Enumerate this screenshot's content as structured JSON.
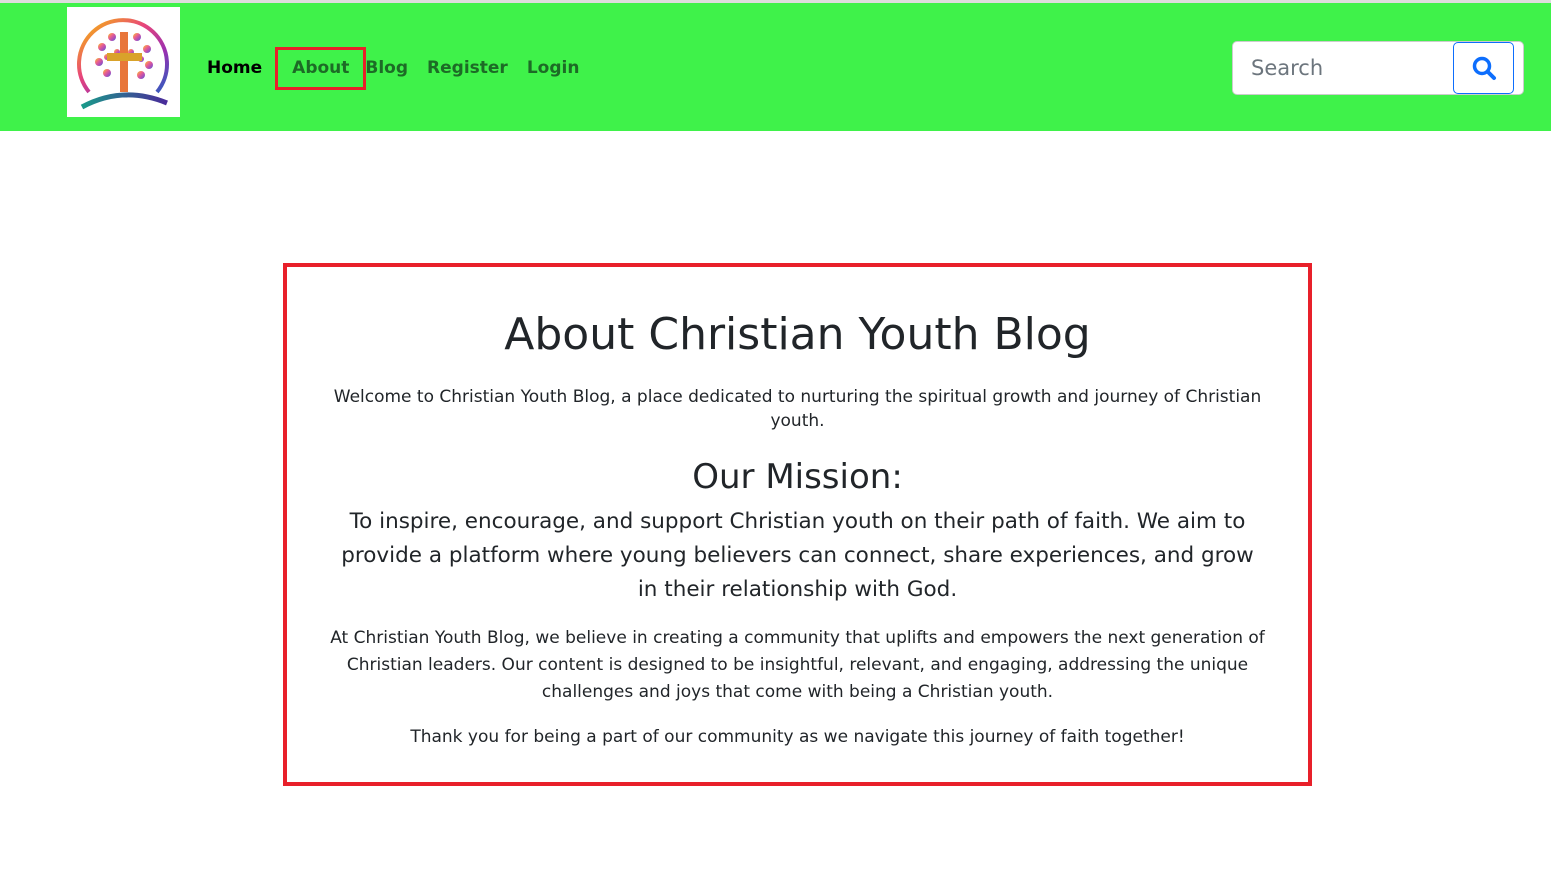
{
  "nav": {
    "links": [
      "Home",
      "About",
      "Blog",
      "Register",
      "Login"
    ],
    "search_placeholder": "Search"
  },
  "colors": {
    "navbar": "#3ff24a",
    "highlight": "#e8202a",
    "accent": "#0d6efd"
  },
  "about": {
    "title": "About Christian Youth Blog",
    "intro": "Welcome to Christian Youth Blog, a place dedicated to nurturing the spiritual growth and journey of Christian youth.",
    "mission_heading": "Our Mission:",
    "mission_text": "To inspire, encourage, and support Christian youth on their path of faith. We aim to provide a platform where young believers can connect, share experiences, and grow in their relationship with God.",
    "body": "At Christian Youth Blog, we believe in creating a community that uplifts and empowers the next generation of Christian leaders. Our content is designed to be insightful, relevant, and engaging, addressing the unique challenges and joys that come with being a Christian youth.",
    "thanks": "Thank you for being a part of our community as we navigate this journey of faith together!"
  }
}
